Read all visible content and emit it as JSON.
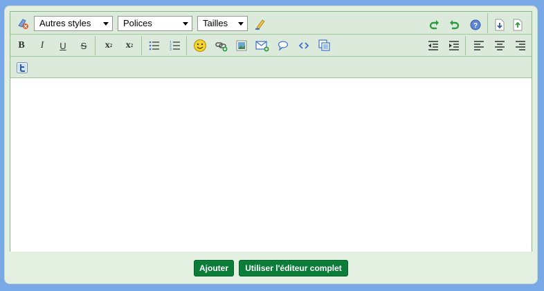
{
  "toolbar": {
    "styles_label": "Autres styles",
    "fonts_label": "Polices",
    "sizes_label": "Tailles",
    "bold_label": "B",
    "italic_label": "I",
    "underline_label": "U",
    "strike_label": "S",
    "subscript_label": "x",
    "subscript_mark": "2",
    "superscript_label": "x",
    "superscript_mark": "2"
  },
  "actions": {
    "add_label": "Ajouter",
    "full_editor_label": "Utiliser l'éditeur complet"
  },
  "editor": {
    "content": ""
  },
  "colors": {
    "page_bg": "#79a8e6",
    "panel_bg": "#e3efe1",
    "toolbar_bg": "#dbeadb",
    "border": "#86b784",
    "action_button": "#0c7c39",
    "icon_green": "#3a9a3a",
    "icon_blue": "#3b6fcf"
  }
}
